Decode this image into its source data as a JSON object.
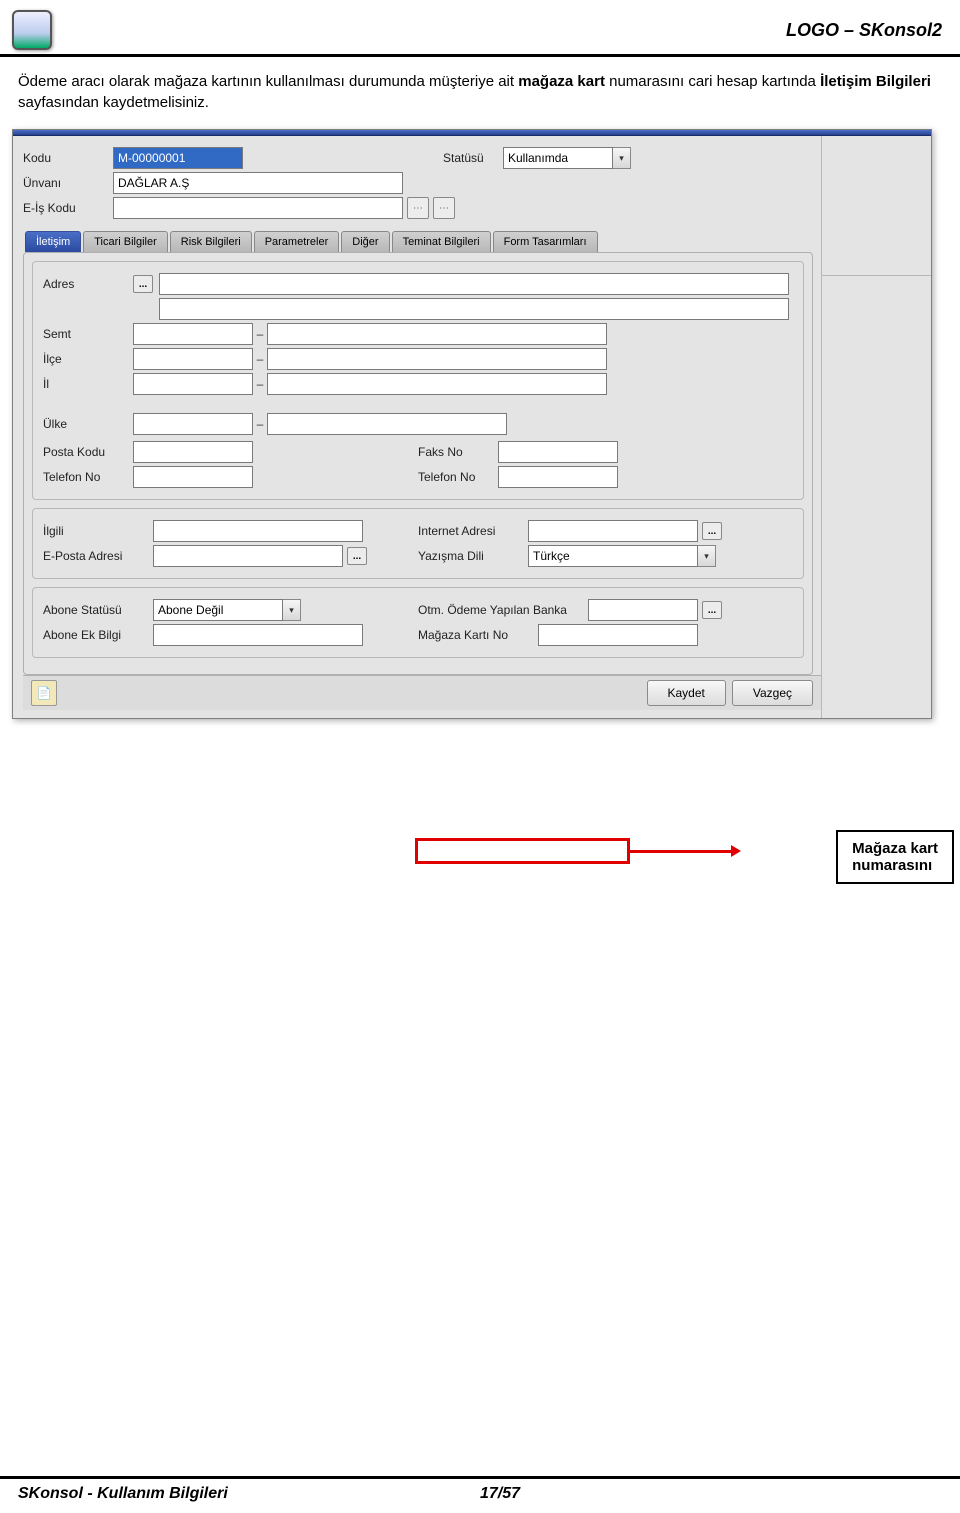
{
  "header": {
    "right_text": "LOGO – SKonsol2"
  },
  "body_paragraph": {
    "p1a": "Ödeme aracı olarak mağaza kartının kullanılması durumunda müşteriye ait ",
    "bold1": "mağaza kart",
    "p1b": " numarasını cari hesap kartında ",
    "bold2": "İletişim Bilgileri",
    "p1c": " sayfasından kaydetmelisiniz."
  },
  "form": {
    "top": {
      "kodu_label": "Kodu",
      "kodu_value": "M-00000001",
      "statu_label": "Statüsü",
      "statu_value": "Kullanımda",
      "unvan_label": "Ünvanı",
      "unvan_value": "DAĞLAR A.Ş",
      "eis_label": "E-İş Kodu",
      "eis_value": ""
    },
    "tabs": [
      "İletişim",
      "Ticari Bilgiler",
      "Risk Bilgileri",
      "Parametreler",
      "Diğer",
      "Teminat Bilgileri",
      "Form Tasarımları"
    ],
    "active_tab": 0,
    "iletisim": {
      "adres_label": "Adres",
      "semt_label": "Semt",
      "ilce_label": "İlçe",
      "il_label": "İl",
      "ulke_label": "Ülke",
      "posta_label": "Posta Kodu",
      "telefon_label": "Telefon No",
      "faks_label": "Faks No",
      "telefon2_label": "Telefon No",
      "ilgili_label": "İlgili",
      "eposta_label": "E-Posta Adresi",
      "internet_label": "Internet Adresi",
      "dil_label": "Yazışma Dili",
      "dil_value": "Türkçe",
      "abone_statu_label": "Abone Statüsü",
      "abone_statu_value": "Abone Değil",
      "abone_ek_label": "Abone Ek Bilgi",
      "otm_banka_label": "Otm. Ödeme Yapılan Banka",
      "magaza_kart_label": "Mağaza Kartı No"
    },
    "buttons": {
      "kaydet": "Kaydet",
      "vazgec": "Vazgeç"
    }
  },
  "callout": {
    "line1": "Mağaza kart",
    "line2": "numarasını"
  },
  "footer": {
    "left": "SKonsol - Kullanım Bilgileri",
    "center": "17/57"
  },
  "icons": {
    "dots": "...",
    "chevron_down": "▾",
    "dash": "–"
  }
}
